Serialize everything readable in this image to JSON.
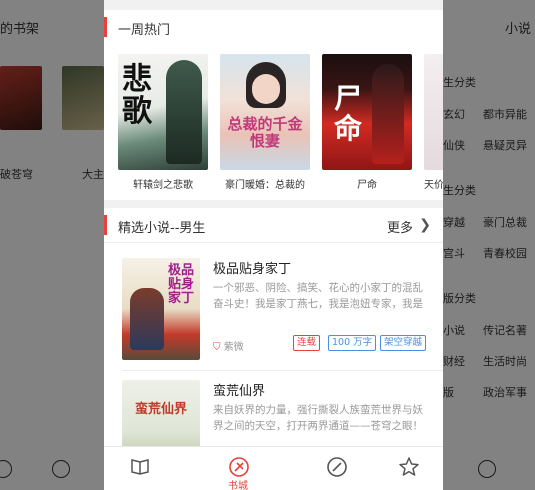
{
  "background_left": {
    "title": "的书架",
    "book_caption_1": "破苍穹",
    "book_caption_2": "大主"
  },
  "background_right": {
    "title": "小说",
    "sections": [
      {
        "label": "生分类",
        "items": [
          "玄幻",
          "都市异能",
          "仙侠",
          "悬疑灵异"
        ]
      },
      {
        "label": "生分类",
        "items": [
          "穿越",
          "豪门总裁",
          "宫斗",
          "青春校园"
        ]
      },
      {
        "label": "版分类",
        "items": [
          "小说",
          "传记名著",
          "财经",
          "生活时尚",
          "版",
          "政治军事"
        ]
      }
    ]
  },
  "hot_section": {
    "title": "一周热门",
    "books": [
      {
        "name": "轩辕剑之悲歌",
        "cover_text": "悲歌"
      },
      {
        "name": "豪门暖婚：总裁的",
        "cover_text": "总裁的千金恨妻"
      },
      {
        "name": "尸命",
        "cover_text": "尸命"
      },
      {
        "name": "天价"
      }
    ]
  },
  "male_section": {
    "title": "精选小说--男生",
    "more_label": "更多",
    "books": [
      {
        "title": "极品贴身家丁",
        "desc": "一个邪恶、阴险、搞笑、花心的小家丁的混乱奋斗史！我是家丁燕七，我是泡妞专家，我是",
        "author": "紫微",
        "tags": [
          "连载",
          "100 万字",
          "架空穿越"
        ],
        "cover_text": "极品贴身家丁"
      },
      {
        "title": "蛮荒仙界",
        "desc": "来自妖界的力量，强行撕裂人族蛮荒世界与妖界之间的天空，打开两界通道——苍穹之眼！",
        "cover_text": "蛮荒仙界"
      }
    ]
  },
  "tabbar": {
    "tabs": [
      {
        "icon": "book-icon"
      },
      {
        "icon": "bookstore-icon",
        "label": "书城",
        "active": true
      },
      {
        "icon": "discover-icon"
      },
      {
        "icon": "star-icon"
      }
    ]
  },
  "colors": {
    "accent": "#e8413c",
    "tag_blue": "#4a90e2"
  }
}
